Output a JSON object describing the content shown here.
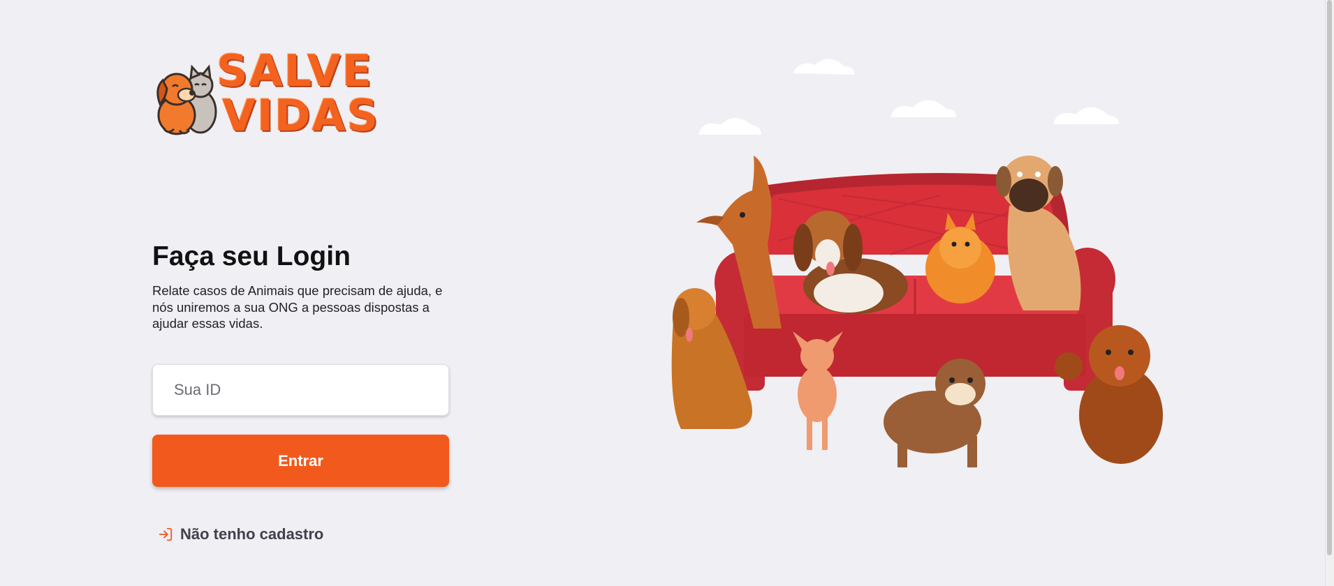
{
  "logo": {
    "line1": "SALVE",
    "line2": "VIDAS",
    "icon": "dog-and-cat-logo-icon"
  },
  "login": {
    "title": "Faça seu Login",
    "description": "Relate casos de Animais que precisam de ajuda, e nós uniremos a sua ONG a pessoas dispostas a ajudar essas vidas.",
    "id_placeholder": "Sua ID",
    "id_value": "",
    "submit_label": "Entrar",
    "register_label": "Não tenho cadastro",
    "register_icon": "log-in-arrow-icon"
  },
  "hero": {
    "image": "dogs-on-red-sofa-illustration"
  },
  "colors": {
    "accent": "#f15a1c",
    "background": "#f0eff4",
    "sofa": "#d9303a",
    "text": "#111111",
    "link": "#41414d"
  }
}
